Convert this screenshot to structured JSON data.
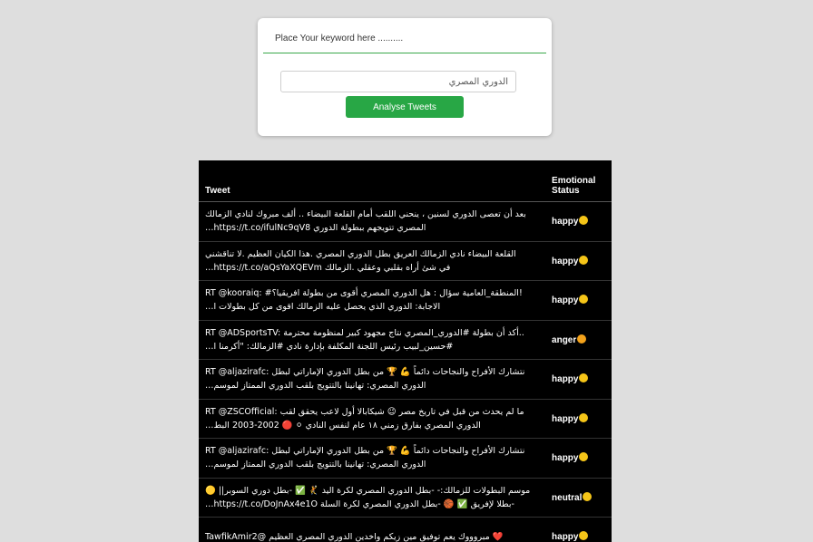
{
  "search": {
    "title": "Place Your keyword here ..........",
    "input_value": "الدوري المصري",
    "button_label": "Analyse Tweets"
  },
  "table": {
    "headers": {
      "tweet": "Tweet",
      "status": "Emotional Status"
    },
    "rows": [
      {
        "tweet_line1": "بعد أن تعصى الدوري لسنين ، ينحني اللقب أمام القلعة البيضاء .. ألف مبروك لنادي الزمالك",
        "tweet_line2": "المصري تتويجهم ببطولة الدوري https://t.co/ifulNc9qV8…",
        "status": "happy",
        "emoji": "grinning-face-icon"
      },
      {
        "tweet_line1": "القلعة البيضاء نادي الزمالك العريق بطل الدوري المصري .هذا الكيان العظيم .لا تناقشني",
        "tweet_line2": "في شئ أراه بقلبي وعقلي .الزمالك https://t.co/aQsYaXQEVm…",
        "status": "happy",
        "emoji": "grinning-face-icon"
      },
      {
        "tweet_line1": "RT @kooraiq: #المنطقة_العامية سؤال : هل الدوري المصري أقوى من بطولة افريقيا؟!",
        "tweet_line2": "الاجابة: الدوري الذي يحصل عليه الزمالك اقوى من كل بطولات ا…",
        "status": "happy",
        "emoji": "grinning-face-icon"
      },
      {
        "tweet_line1": "RT @ADSportsTV: أكد أن بطولة #الدوري_المصري نتاج مجهود كبير لمنظومة محترمة..",
        "tweet_line2": "#حسين_لبيب رئيس اللجنة المكلفة بإدارة نادي #الزمالك: \"أكرمنا ا…",
        "status": "anger",
        "emoji": "angry-face-icon"
      },
      {
        "tweet_line1": "RT @aljazirafc: نتشارك الأفراح والنجاحات دائماً 💪 🏆 من بطل الدوري الإماراتي لبطل",
        "tweet_line2": "الدوري المصري: تهانينا بالتتويج بلقب الدوري الممتاز لموسم…",
        "status": "happy",
        "emoji": "grinning-face-icon"
      },
      {
        "tweet_line1": "RT @ZSCOfficial: ما لم يحدث من قبل في تاريخ مصر 😉 شيكابالا أول لاعب يحقق لقب",
        "tweet_line2": "الدوري المصري بفارق زمني ١٨ عام لنفس النادي ⚪ 🔴 2002-2003 البط…",
        "status": "happy",
        "emoji": "grinning-face-icon"
      },
      {
        "tweet_line1": "RT @aljazirafc: نتشارك الأفراح والنجاحات دائماً 💪 🏆 من بطل الدوري الإماراتي لبطل",
        "tweet_line2": "الدوري المصري: تهانينا بالتتويج بلقب الدوري الممتاز لموسم…",
        "status": "happy",
        "emoji": "grinning-face-icon"
      },
      {
        "tweet_line1": "موسم البطولات للزمالك:- -بطل الدوري المصري لكرة اليد 🤾 ✅ -بطل دوري السوبر|| 🟡",
        "tweet_line2": "-بطلا لإفريق ✅ 🏀 -بطل الدوري المصري لكرة السلة https://t.co/DoJnAx4e1O…",
        "status": "neutral",
        "emoji": "smiling-face-icon"
      },
      {
        "tweet_line1": "❤️ مبروووك يعم توفيق مين زيكم واخدين الدوري المصري العظيم @TawfikAmir2",
        "tweet_line2": "",
        "status": "happy",
        "emoji": "grinning-face-icon"
      }
    ]
  }
}
